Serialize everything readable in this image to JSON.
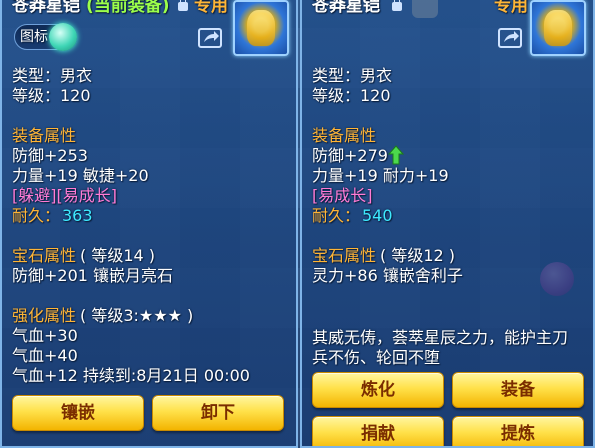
{
  "left": {
    "name": "苍莽星铠",
    "status": "(当前装备)",
    "tag": "专用",
    "toggle_label": "图标",
    "type": "类型：男衣",
    "level": "等级：120",
    "attr_header": "装备属性",
    "defense": "防御+253",
    "power_agility": "力量+19 敏捷+20",
    "special": "[躲避][易成长]",
    "durability_label": "耐久：",
    "durability_value": "363",
    "gem_header": "宝石属性",
    "gem_level": "( 等级14 )",
    "gem_line": "防御+201 镶嵌月亮石",
    "enhance_header": "强化属性",
    "enhance_level": "( 等级3:★★★ )",
    "enhance_lines": [
      "气血+30",
      "气血+40",
      "气血+12    持续到:8月21日 00:00"
    ],
    "buttons": [
      "镶嵌",
      "卸下"
    ]
  },
  "right": {
    "name": "苍莽星铠",
    "tag": "专用",
    "type": "类型：男衣",
    "level": "等级：120",
    "attr_header": "装备属性",
    "defense": "防御+279",
    "power_endurance": "力量+19 耐力+19",
    "special": "[易成长]",
    "durability_label": "耐久：",
    "durability_value": "540",
    "gem_header": "宝石属性",
    "gem_level": "( 等级12 )",
    "gem_line": "灵力+86 镶嵌舍利子",
    "description_lines": [
      "其威无俦，荟萃星辰之力，能护主刀",
      "兵不伤、轮回不堕"
    ],
    "buttons": [
      "炼化",
      "装备",
      "捐献",
      "提炼"
    ]
  },
  "colors": {
    "orange": "#ffb536",
    "green": "#9cff4a",
    "pink": "#ff7bd5",
    "cyan": "#3ee9ff",
    "button_text": "#7a2d00"
  },
  "icons": {
    "lock": "lock-icon",
    "share": "share-icon",
    "avatar": "armor-avatar-icon",
    "up_arrow": "up-arrow-icon"
  }
}
